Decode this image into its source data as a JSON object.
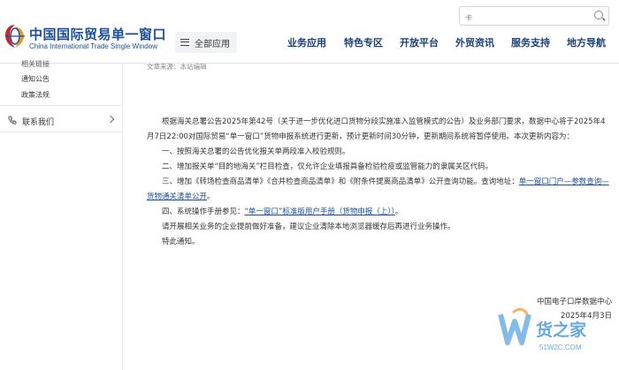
{
  "header": {
    "logo_cn": "中国国际贸易单一窗口",
    "logo_en": "China International Trade Single Window",
    "all_apps": "全部应用",
    "search_placeholder": "卡",
    "nav": [
      "业务应用",
      "特色专区",
      "开放平台",
      "外贸资讯",
      "服务支持",
      "地方导航"
    ]
  },
  "sidebar": {
    "partial_top": "相关链接",
    "links": [
      "通知公告",
      "政策法规"
    ],
    "contact": "联系我们"
  },
  "article": {
    "source": "文章来源：本站编辑",
    "intro": "根据海关总署公告2025年第42号（关于进一步优化进口货物分段实施准入监管模式的公告）及业务部门要求，数据中心将于2025年4月7日22:00对国际贸易“单一窗口”货物申报系统进行更新，预计更新时间30分钟，更新期间系统将暂停使用。本次更新内容为：",
    "item1": "一、按照海关总署的公告优化报关单两段准入校验规则。",
    "item2": "二、增加报关单“目的地海关”栏目检查，仅允许企业填报具备检验检疫或监管能力的隶属关区代码。",
    "item3_prefix": "三、增加《转场检查商品清单》《合并检查商品清单》和《附条件提离商品清单》公开查询功能。查询地址：",
    "item3_link": "单一窗口门户—参数查询—货物通关清单公开",
    "item3_suffix": "。",
    "item4_prefix": "四、系统操作手册参见：",
    "item4_link": "“单一窗口”标准版用户手册（货物申报（上））",
    "item4_suffix": "。",
    "note": "请开展相关业务的企业提前做好准备，建议企业清除本地浏览器缓存后再进行业务操作。",
    "closing": "特此通知。",
    "signer": "中国电子口岸数据中心",
    "date": "2025年4月3日"
  },
  "watermark": {
    "brand": "货之家",
    "url": "51W2C.COM"
  }
}
